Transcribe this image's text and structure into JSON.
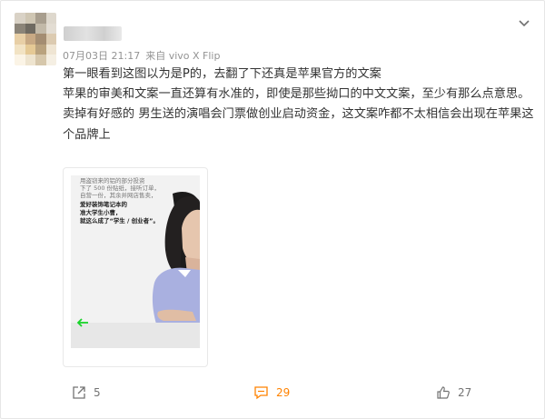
{
  "post": {
    "meta": {
      "time": "07月03日 21:17",
      "source": "来自 vivo X Flip"
    },
    "paragraphs": [
      "第一眼看到这图以为是P的，去翻了下还真是苹果官方的文案",
      "苹果的审美和文案一直还算有水准的，即使是那些拗口的中文文案，至少有那么点意思。",
      "卖掉有好感的 男生送的演唱会门票做创业启动资金，这文案咋都不太相信会出现在苹果这个品牌上"
    ],
    "image_text": {
      "faded": [
        "用盗窃来的铝的部分投资",
        "下了 500 份贴纸，接听订单，",
        "自营一份，其余并网店售卖，"
      ],
      "bold": [
        "爱好装饰笔记本的",
        "准大学生小曹，",
        "就这么成了“学生 / 创业者”。"
      ]
    },
    "colors": {
      "accent": "#ff8200",
      "arrow": "#19d42a",
      "muted": "#939393",
      "shirt": "#a9b0e0"
    }
  },
  "actions": {
    "share": {
      "icon": "share-icon",
      "count": "5"
    },
    "comment": {
      "icon": "comment-icon",
      "count": "29"
    },
    "like": {
      "icon": "thumbs-up-icon",
      "count": "27"
    }
  }
}
